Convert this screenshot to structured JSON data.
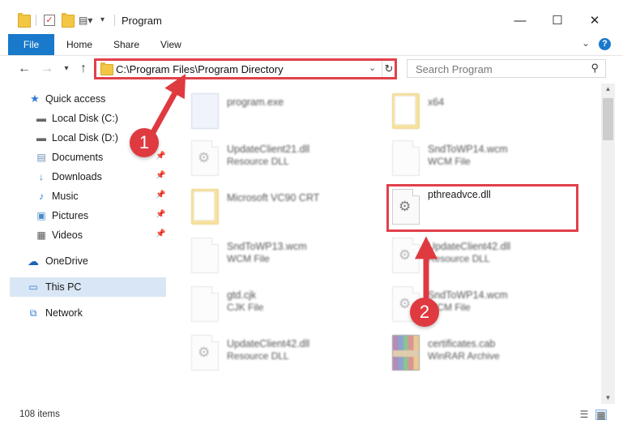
{
  "window": {
    "title": "Program",
    "controls": {
      "minimize": "—",
      "maximize": "☐",
      "close": "✕"
    }
  },
  "ribbon": {
    "tabs": [
      {
        "label": "File"
      },
      {
        "label": "Home"
      },
      {
        "label": "Share"
      },
      {
        "label": "View"
      }
    ],
    "help": "?"
  },
  "address": {
    "path": "C:\\Program Files\\Program Directory",
    "search_placeholder": "Search Program"
  },
  "sidebar": {
    "items": [
      {
        "label": "Quick access",
        "icon": "star-icon"
      },
      {
        "label": "Local Disk (C:)",
        "icon": "drive-icon",
        "pinned": true
      },
      {
        "label": "Local Disk (D:)",
        "icon": "drive-icon",
        "pinned": true
      },
      {
        "label": "Documents",
        "icon": "documents-icon",
        "pinned": true
      },
      {
        "label": "Downloads",
        "icon": "downloads-icon",
        "pinned": true
      },
      {
        "label": "Music",
        "icon": "music-icon",
        "pinned": true
      },
      {
        "label": "Pictures",
        "icon": "pictures-icon",
        "pinned": true
      },
      {
        "label": "Videos",
        "icon": "videos-icon",
        "pinned": true
      },
      {
        "label": "OneDrive",
        "icon": "cloud-icon"
      },
      {
        "label": "This PC",
        "icon": "computer-icon",
        "selected": true
      },
      {
        "label": "Network",
        "icon": "network-icon"
      }
    ]
  },
  "files": [
    {
      "name": "program.exe",
      "type": "",
      "icon": "exe-icon"
    },
    {
      "name": "x64",
      "type": "",
      "icon": "folder-icon"
    },
    {
      "name": "UpdateClient21.dll",
      "type": "Resource DLL",
      "icon": "dll-icon"
    },
    {
      "name": "SndToWP14.wcm",
      "type": "WCM File",
      "icon": "document-icon"
    },
    {
      "name": "Microsoft VC90 CRT",
      "type": "",
      "icon": "folder-icon"
    },
    {
      "name": "pthreadvce.dll",
      "type": "",
      "icon": "dll-icon"
    },
    {
      "name": "SndToWP13.wcm",
      "type": "WCM File",
      "icon": "document-icon"
    },
    {
      "name": "UpdateClient42.dll",
      "type": "Resource DLL",
      "icon": "dll-icon"
    },
    {
      "name": "gtd.cjk",
      "type": "CJK File",
      "icon": "document-icon"
    },
    {
      "name": "SndToWP14.wcm",
      "type": "WCM File",
      "icon": "dll-icon"
    },
    {
      "name": "UpdateClient42.dll",
      "type": "Resource DLL",
      "icon": "dll-icon"
    },
    {
      "name": "certificates.cab",
      "type": "WinRAR Archive",
      "icon": "archive-icon"
    }
  ],
  "status": {
    "item_count": "108 items"
  },
  "annotations": {
    "step1": "1",
    "step2": "2",
    "color": "#df3a40"
  }
}
